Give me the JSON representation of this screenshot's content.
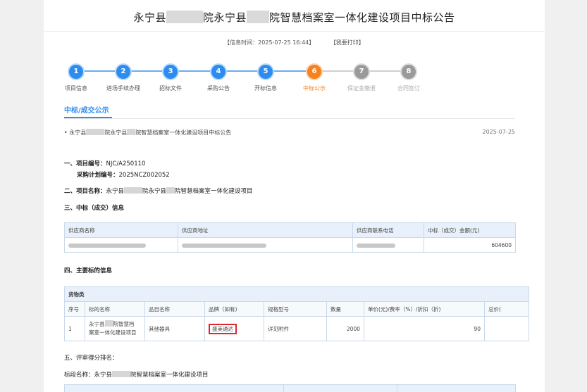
{
  "title": {
    "prefix": "永宁县",
    "middle": "院永宁县",
    "suffix": "院智慧档案室一体化建设项目中标公告"
  },
  "info": {
    "time_label": "【信息时间：2025-07-25 16:44】",
    "print_label": "【我要打印】"
  },
  "steps": [
    {
      "num": "1",
      "label": "项目信息"
    },
    {
      "num": "2",
      "label": "进场手续办理"
    },
    {
      "num": "3",
      "label": "招标文件"
    },
    {
      "num": "4",
      "label": "采购公告"
    },
    {
      "num": "5",
      "label": "开标信息"
    },
    {
      "num": "6",
      "label": "中标公示"
    },
    {
      "num": "7",
      "label": "保证金缴退"
    },
    {
      "num": "8",
      "label": "合同签订"
    }
  ],
  "tab_label": "中标/成交公示",
  "notice": {
    "bullet": "•",
    "part1": "永宁县",
    "part2": "院永宁县",
    "part3": "院智慧档案室一体化建设项目中标公告",
    "date": "2025-07-25"
  },
  "section1": {
    "heading": "一、项目编号：",
    "project_no": "NJC/A250110",
    "plan_label": "采购计划编号：",
    "plan_no": "2025NCZ002052"
  },
  "section2": {
    "heading": "二、项目名称：",
    "part1": "永宁县",
    "part2": "院永宁县",
    "part3": "院智慧档案室一体化建设项目"
  },
  "section3": {
    "heading": "三、中标（成交）信息"
  },
  "supplier_table": {
    "headers": [
      "供应商名称",
      "供应商地址",
      "供应商联系电话",
      "中标（成交）金额(元)"
    ],
    "amount": "604600"
  },
  "section4": {
    "heading": "四、主要标的信息"
  },
  "goods_table": {
    "group": "货物类",
    "headers": [
      "序号",
      "标的名称",
      "品目名称",
      "品牌（如有)",
      "规格型号",
      "数量",
      "单价(元)/费率（%）/折扣（折)",
      "总价("
    ],
    "row": {
      "index": "1",
      "name_part1": "永宁县",
      "name_part2": "院智慧档",
      "name_part3": "案室一体化建设项目",
      "category": "其他器具",
      "brand": "盛美通达",
      "spec": "详见附件",
      "qty": "2000",
      "unit_price": "90"
    }
  },
  "section5": {
    "heading": "五、评审得分排名："
  },
  "bid_section": {
    "label": "标段名称：",
    "part1": "永宁县",
    "part2": "院智慧档案室一体化建设项目"
  },
  "colors": {
    "accent": "#2d8cf0",
    "active_step": "#f5811f",
    "highlight_box": "#e0262f"
  }
}
